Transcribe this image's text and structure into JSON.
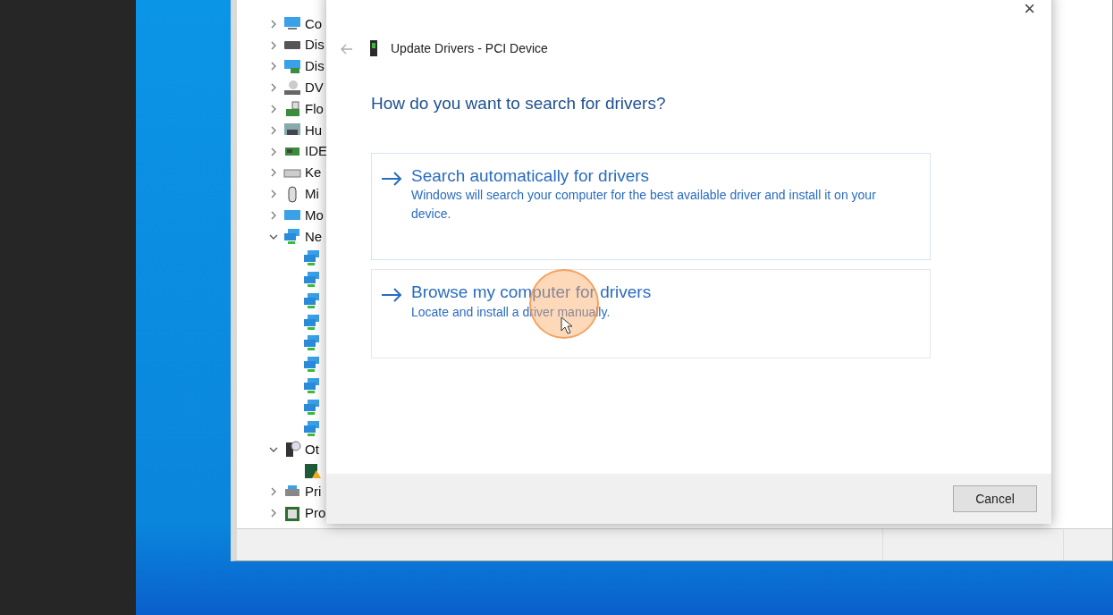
{
  "device_tree": {
    "items": [
      {
        "label": "Co",
        "kind": "computer",
        "expanded": false
      },
      {
        "label": "Dis",
        "kind": "disk",
        "expanded": false
      },
      {
        "label": "Dis",
        "kind": "display",
        "expanded": false
      },
      {
        "label": "DV",
        "kind": "dvd",
        "expanded": false
      },
      {
        "label": "Flo",
        "kind": "floppy",
        "expanded": false
      },
      {
        "label": "Hu",
        "kind": "hid",
        "expanded": false
      },
      {
        "label": "IDE",
        "kind": "ide",
        "expanded": false
      },
      {
        "label": "Ke",
        "kind": "keyboard",
        "expanded": false
      },
      {
        "label": "Mi",
        "kind": "mouse",
        "expanded": false
      },
      {
        "label": "Mo",
        "kind": "monitor",
        "expanded": false
      },
      {
        "label": "Ne",
        "kind": "network",
        "expanded": true,
        "children": [
          {
            "kind": "network"
          },
          {
            "kind": "network"
          },
          {
            "kind": "network"
          },
          {
            "kind": "network"
          },
          {
            "kind": "network"
          },
          {
            "kind": "network"
          },
          {
            "kind": "network"
          },
          {
            "kind": "network"
          },
          {
            "kind": "network"
          }
        ]
      },
      {
        "label": "Ot",
        "kind": "other",
        "expanded": true,
        "children": [
          {
            "kind": "unknown"
          }
        ]
      },
      {
        "label": "Pri",
        "kind": "printer",
        "expanded": false
      },
      {
        "label": "Pro",
        "kind": "processor",
        "expanded": false
      }
    ]
  },
  "dialog": {
    "close": "×",
    "back_disabled": true,
    "title": "Update Drivers - PCI Device",
    "heading": "How do you want to search for drivers?",
    "options": [
      {
        "title": "Search automatically for drivers",
        "description": "Windows will search your computer for the best available driver and install it on your device.",
        "hovered": false
      },
      {
        "title": "Browse my computer for drivers",
        "description": "Locate and install a driver manually.",
        "hovered": true
      }
    ],
    "buttons": [
      "Cancel"
    ]
  }
}
